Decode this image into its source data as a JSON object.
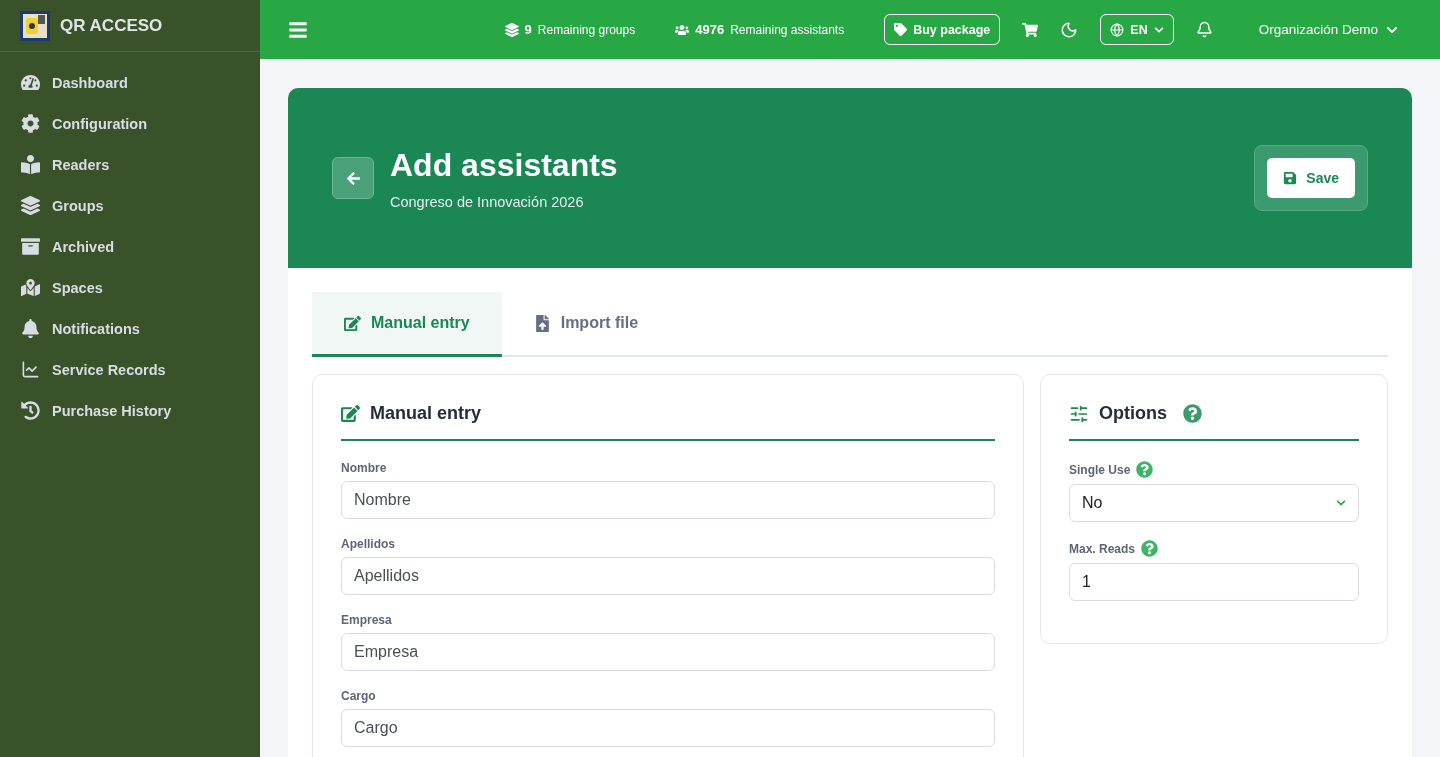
{
  "brand": {
    "name": "QR ACCESO"
  },
  "sidebar": {
    "items": [
      {
        "label": "Dashboard"
      },
      {
        "label": "Configuration"
      },
      {
        "label": "Readers"
      },
      {
        "label": "Groups"
      },
      {
        "label": "Archived"
      },
      {
        "label": "Spaces"
      },
      {
        "label": "Notifications"
      },
      {
        "label": "Service Records"
      },
      {
        "label": "Purchase History"
      }
    ]
  },
  "topbar": {
    "stats": [
      {
        "count": "9",
        "label": "Remaining groups"
      },
      {
        "count": "4976",
        "label": "Remaining assistants"
      }
    ],
    "buy_button": "Buy package",
    "language": "EN",
    "user": "Organización Demo"
  },
  "header": {
    "title": "Add assistants",
    "subtitle": "Congreso de Innovación 2026",
    "save_button": "Save"
  },
  "tabs": [
    {
      "label": "Manual entry",
      "selected": true
    },
    {
      "label": "Import file",
      "selected": false
    }
  ],
  "manual_entry": {
    "title": "Manual entry",
    "fields": [
      {
        "label": "Nombre",
        "placeholder": "Nombre"
      },
      {
        "label": "Apellidos",
        "placeholder": "Apellidos"
      },
      {
        "label": "Empresa",
        "placeholder": "Empresa"
      },
      {
        "label": "Cargo",
        "placeholder": "Cargo"
      }
    ]
  },
  "options": {
    "title": "Options",
    "fields": [
      {
        "kind": "select",
        "label": "Single Use",
        "value": "No"
      },
      {
        "kind": "input",
        "label": "Max. Reads",
        "value": "1"
      }
    ]
  }
}
